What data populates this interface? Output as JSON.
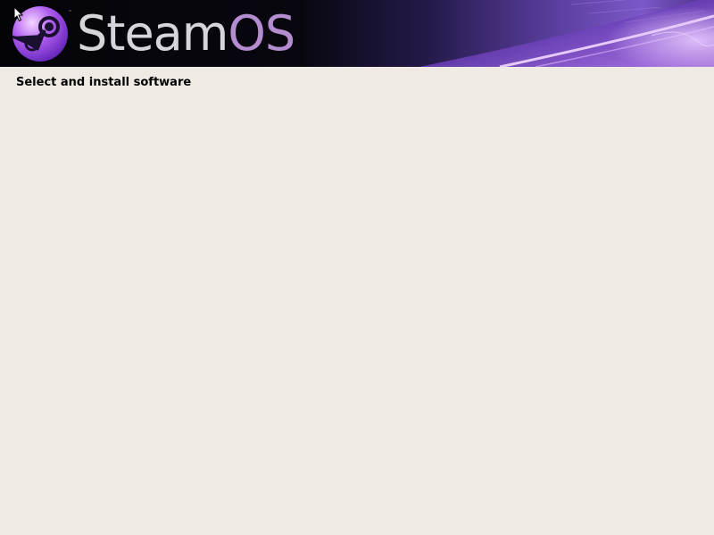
{
  "header": {
    "brand": {
      "name_part1": "Steam",
      "name_part2": "OS",
      "trademark": "™"
    },
    "colors": {
      "banner_background": "#05050a",
      "accent_purple": "#8a3fd6",
      "wordmark_light": "#d6d6da"
    }
  },
  "main": {
    "title": "Select and install software",
    "background_color": "#efebe4"
  }
}
